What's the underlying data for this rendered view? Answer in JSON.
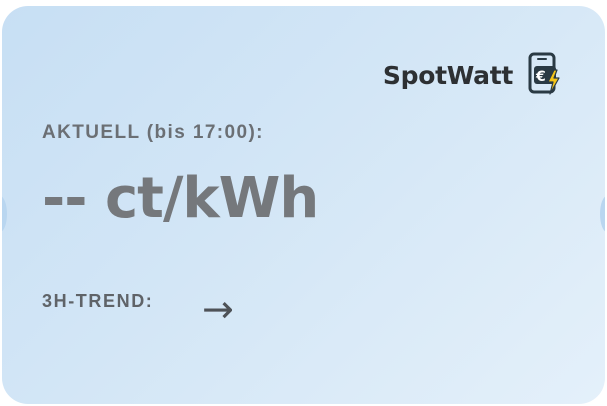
{
  "app": {
    "name": "SpotWatt",
    "logo_icon": "phone-euro-bolt-icon"
  },
  "current": {
    "label": "AKTUELL (bis 17:00):",
    "price": "-- ct/kWh"
  },
  "trend": {
    "label": "3H-TREND:",
    "arrow": "→",
    "arrow_icon": "arrow-right-icon"
  },
  "colors": {
    "background_start": "#c7dff4",
    "background_end": "#e4f0fa",
    "brand_text": "#2d3033",
    "logo_outline": "#2a3a44",
    "logo_accent": "#f5c518"
  }
}
